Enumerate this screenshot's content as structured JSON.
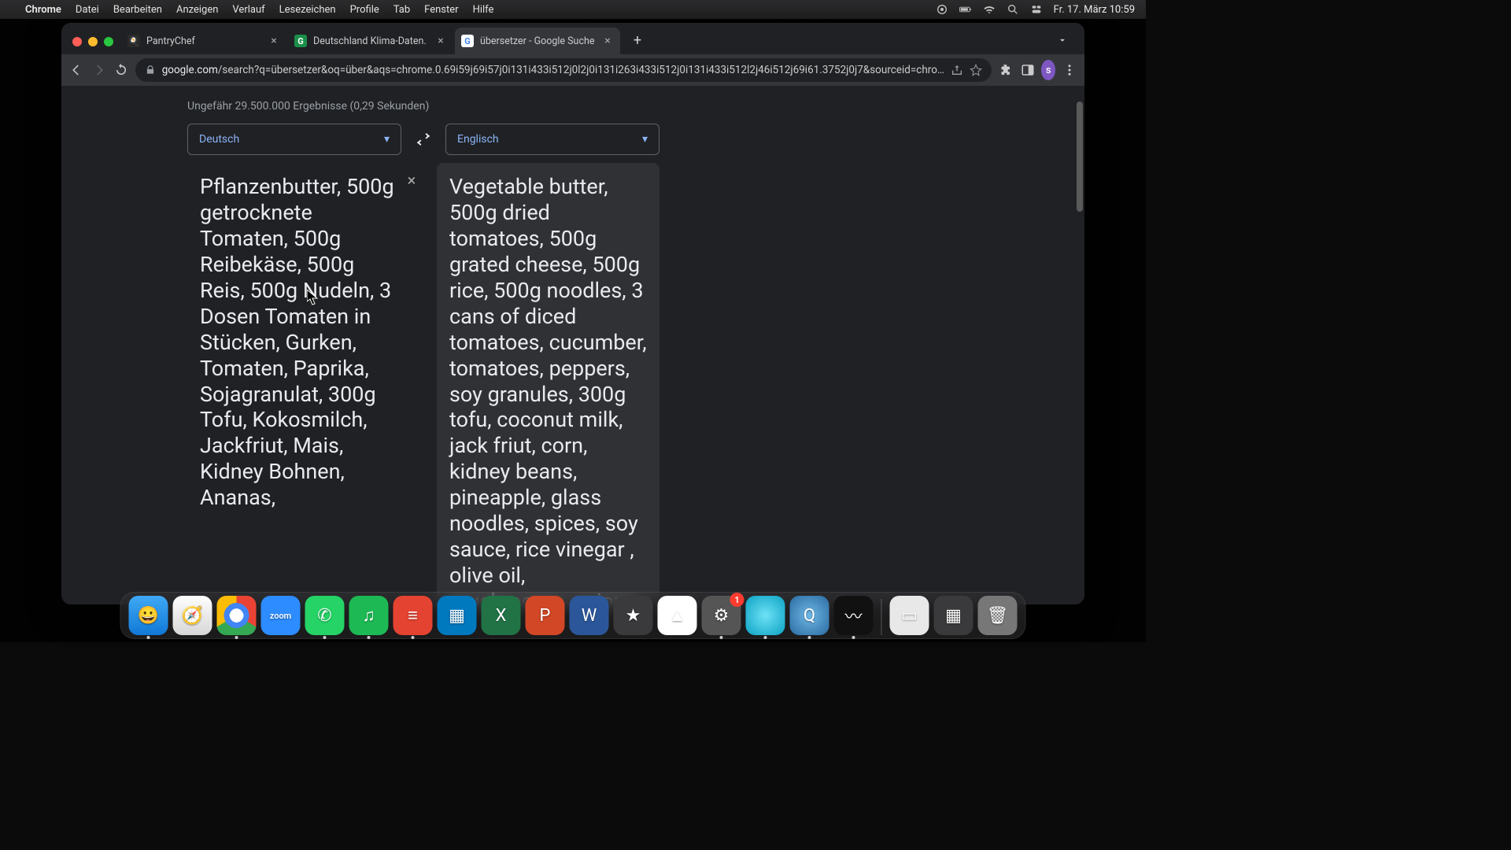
{
  "menubar": {
    "app": "Chrome",
    "items": [
      "Datei",
      "Bearbeiten",
      "Anzeigen",
      "Verlauf",
      "Lesezeichen",
      "Profile",
      "Tab",
      "Fenster",
      "Hilfe"
    ],
    "clock": "Fr. 17. März  10:59"
  },
  "browser": {
    "tabs": [
      {
        "title": "PantryChef",
        "favicon": "🥘",
        "active": false
      },
      {
        "title": "Deutschland Klima-Daten.",
        "favicon": "G",
        "active": false
      },
      {
        "title": "übersetzer - Google Suche",
        "favicon": "G",
        "active": true
      }
    ],
    "url_display_prefix": "google.com",
    "url_display_rest": "/search?q=übersetzer&oq=über&aqs=chrome.0.69i59j69i57j0i131i433i512j0l2j0i131i263i433i512j0i131i433i512l2j46i512j69i61.3752j0j7&sourceid=chro…",
    "avatar_letter": "s"
  },
  "search": {
    "results_line": "Ungefähr 29.500.000 Ergebnisse (0,29 Sekunden)"
  },
  "translate": {
    "source_lang": "Deutsch",
    "target_lang": "Englisch",
    "source_text": "Pflanzenbutter, 500g getrocknete Tomaten, 500g Reibekäse, 500g Reis, 500g Nudeln, 3 Dosen Tomaten in Stücken, Gurken, Tomaten, Paprika, Sojagranulat, 300g Tofu, Kokosmilch, Jackfriut, Mais, Kidney Bohnen, Ananas,",
    "target_text": "Vegetable butter, 500g dried tomatoes, 500g grated cheese, 500g rice, 500g noodles, 3 cans of diced tomatoes, cucumber, tomatoes, peppers, soy granules, 300g tofu, coconut milk, jack friut, corn, kidney beans, pineapple, glass noodles, spices, soy sauce, rice vinegar , olive oil, mushrooms, onions,"
  },
  "dock": {
    "apps": [
      {
        "n": "finder",
        "g": "😀",
        "running": true
      },
      {
        "n": "safari",
        "g": "🧭",
        "running": false
      },
      {
        "n": "chrome-d",
        "g": "",
        "running": true
      },
      {
        "n": "zoom",
        "g": "zoom",
        "running": false,
        "small": true
      },
      {
        "n": "whatsapp",
        "g": "✆",
        "running": true
      },
      {
        "n": "spotify",
        "g": "♫",
        "running": true
      },
      {
        "n": "todoist",
        "g": "≡",
        "running": true
      },
      {
        "n": "trello",
        "g": "▦",
        "running": false
      },
      {
        "n": "excel",
        "g": "X",
        "running": false
      },
      {
        "n": "ppt",
        "g": "P",
        "running": false
      },
      {
        "n": "word",
        "g": "W",
        "running": false
      },
      {
        "n": "imovie",
        "g": "★",
        "running": false
      },
      {
        "n": "drive",
        "g": "▲",
        "running": false
      },
      {
        "n": "settings",
        "g": "⚙︎",
        "running": true,
        "badge": "1"
      },
      {
        "n": "blank-blue",
        "g": "",
        "running": true
      },
      {
        "n": "qt",
        "g": "Q",
        "running": true
      },
      {
        "n": "voice",
        "g": "〰",
        "running": true
      }
    ],
    "right": [
      {
        "n": "desk-a",
        "g": "▭"
      },
      {
        "n": "desk-b",
        "g": "▦"
      },
      {
        "n": "trash",
        "g": "🗑"
      }
    ]
  }
}
